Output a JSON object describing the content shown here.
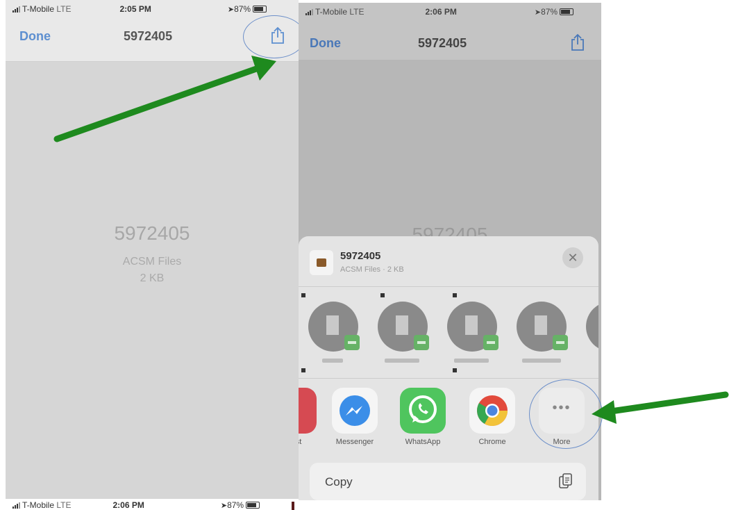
{
  "left_phone": {
    "status": {
      "carrier": "T-Mobile",
      "network": "LTE",
      "time": "2:05 PM",
      "battery": "87%"
    },
    "nav": {
      "done_label": "Done",
      "title": "5972405"
    },
    "file": {
      "name": "5972405",
      "type": "ACSM Files",
      "size": "2 KB"
    }
  },
  "right_phone": {
    "status": {
      "carrier": "T-Mobile",
      "network": "LTE",
      "time": "2:06 PM",
      "battery": "87%"
    },
    "nav": {
      "done_label": "Done",
      "title": "5972405"
    },
    "background_file_name": "5972405",
    "share_sheet": {
      "file_name": "5972405",
      "file_meta": "ACSM Files · 2 KB",
      "apps": [
        {
          "label": "st",
          "icon": "partial-app-icon"
        },
        {
          "label": "Messenger",
          "icon": "messenger-icon"
        },
        {
          "label": "WhatsApp",
          "icon": "whatsapp-icon"
        },
        {
          "label": "Chrome",
          "icon": "chrome-icon"
        },
        {
          "label": "More",
          "icon": "more-icon"
        }
      ],
      "copy_label": "Copy"
    }
  },
  "bottom_status": {
    "carrier": "T-Mobile",
    "network": "LTE",
    "time": "2:06 PM",
    "battery": "87%"
  },
  "colors": {
    "accent": "#5d8fd0",
    "arrow": "#1e8a1e",
    "annotation_ring": "#6c8fc9"
  }
}
